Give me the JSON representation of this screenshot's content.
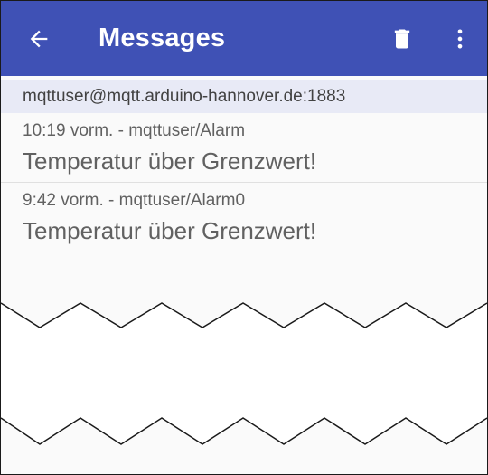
{
  "app_bar": {
    "title": "Messages",
    "color": "#3f51b5",
    "icons": [
      "arrow-back-icon",
      "delete-icon",
      "more-vert-icon"
    ]
  },
  "server": {
    "address": "mqttuser@mqtt.arduino-hannover.de:1883"
  },
  "messages": [
    {
      "meta": "10:19 vorm. - mqttuser/Alarm",
      "text": "Temperatur über Grenzwert!"
    },
    {
      "meta": "9:42 vorm. - mqttuser/Alarm0",
      "text": "Temperatur über Grenzwert!"
    }
  ]
}
